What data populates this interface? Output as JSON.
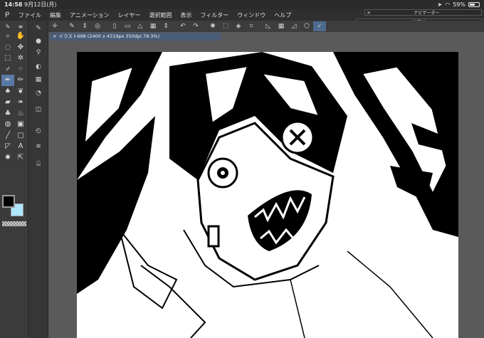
{
  "status": {
    "time": "14:58",
    "date": "9月12日(月)",
    "battery": "59%",
    "battery_level": 0.59
  },
  "menu": {
    "logo": "clip-studio-logo-icon",
    "items": [
      "ファイル",
      "編集",
      "アニメーション",
      "レイヤー",
      "選択範囲",
      "表示",
      "フィルター",
      "ウィンドウ",
      "ヘルプ"
    ]
  },
  "palettes": {
    "navigator": "ナビゲーター",
    "subview": "サブビュー"
  },
  "document": {
    "tab_title": "イラスト698 (2400 x 4319px 350dpi 78.3%)"
  },
  "colors": {
    "main": "#000000",
    "sub": "#aee7ff",
    "accent": "#5a7aa6"
  }
}
